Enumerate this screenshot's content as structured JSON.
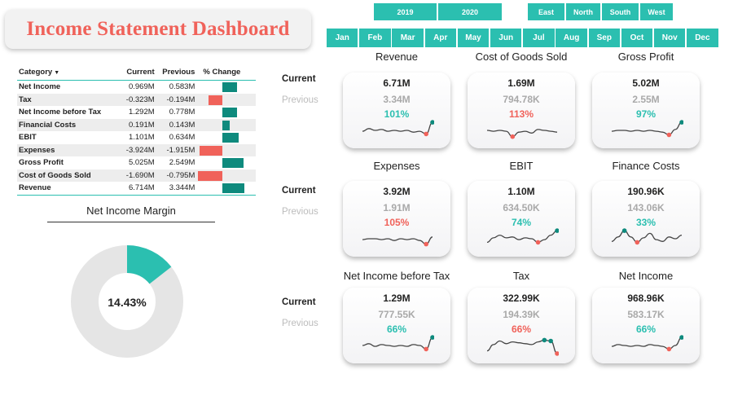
{
  "title": "Income Statement Dashboard",
  "years": [
    "2019",
    "2020"
  ],
  "regions": [
    "East",
    "North",
    "South",
    "West"
  ],
  "months": [
    "Jan",
    "Feb",
    "Mar",
    "Apr",
    "May",
    "Jun",
    "Jul",
    "Aug",
    "Sep",
    "Oct",
    "Nov",
    "Dec"
  ],
  "table": {
    "headers": {
      "category": "Category",
      "current": "Current",
      "previous": "Previous",
      "change": "% Change"
    },
    "rows": [
      {
        "category": "Net Income",
        "current": "0.969M",
        "previous": "0.583M",
        "change_pct": 66
      },
      {
        "category": "Tax",
        "current": "-0.323M",
        "previous": "-0.194M",
        "change_pct": -66
      },
      {
        "category": "Net Income before Tax",
        "current": "1.292M",
        "previous": "0.778M",
        "change_pct": 66
      },
      {
        "category": "Financial Costs",
        "current": "0.191M",
        "previous": "0.143M",
        "change_pct": 33
      },
      {
        "category": "EBIT",
        "current": "1.101M",
        "previous": "0.634M",
        "change_pct": 74
      },
      {
        "category": "Expenses",
        "current": "-3.924M",
        "previous": "-1.915M",
        "change_pct": -105
      },
      {
        "category": "Gross Profit",
        "current": "5.025M",
        "previous": "2.549M",
        "change_pct": 97
      },
      {
        "category": "Cost of Goods Sold",
        "current": "-1.690M",
        "previous": "-0.795M",
        "change_pct": -113
      },
      {
        "category": "Revenue",
        "current": "6.714M",
        "previous": "3.344M",
        "change_pct": 101
      }
    ]
  },
  "net_income_margin": {
    "title": "Net Income Margin",
    "value_label": "14.43%",
    "value": 14.43
  },
  "row_labels": {
    "current": "Current",
    "previous": "Previous"
  },
  "colors": {
    "teal": "#2bbfb0",
    "dark_teal": "#0e8a7d",
    "red": "#f0625a",
    "grey": "#e5e5e5"
  },
  "cards": [
    {
      "title": "Revenue",
      "current": "6.71M",
      "previous": "3.34M",
      "pct": "101%",
      "good": true,
      "spark": [
        0.45,
        0.6,
        0.5,
        0.55,
        0.45,
        0.5,
        0.45,
        0.5,
        0.4,
        0.45,
        0.3,
        0.95
      ],
      "low": 10,
      "high": 11
    },
    {
      "title": "Cost of Goods Sold",
      "current": "1.69M",
      "previous": "794.78K",
      "pct": "113%",
      "good": false,
      "spark": [
        0.5,
        0.45,
        0.5,
        0.45,
        0.15,
        0.4,
        0.45,
        0.35,
        0.55,
        0.5,
        0.45,
        0.4
      ],
      "low": 4,
      "high": null
    },
    {
      "title": "Gross Profit",
      "current": "5.02M",
      "previous": "2.55M",
      "pct": "97%",
      "good": true,
      "spark": [
        0.45,
        0.5,
        0.5,
        0.45,
        0.5,
        0.45,
        0.5,
        0.45,
        0.4,
        0.25,
        0.55,
        0.95
      ],
      "low": 9,
      "high": 11
    },
    {
      "title": "Expenses",
      "current": "3.92M",
      "previous": "1.91M",
      "pct": "105%",
      "good": false,
      "spark": [
        0.45,
        0.5,
        0.5,
        0.45,
        0.5,
        0.4,
        0.5,
        0.45,
        0.5,
        0.4,
        0.2,
        0.6
      ],
      "low": 10,
      "high": null
    },
    {
      "title": "EBIT",
      "current": "1.10M",
      "previous": "634.50K",
      "pct": "74%",
      "good": true,
      "spark": [
        0.3,
        0.55,
        0.7,
        0.55,
        0.6,
        0.45,
        0.55,
        0.5,
        0.3,
        0.45,
        0.7,
        0.95
      ],
      "low": 8,
      "high": 11
    },
    {
      "title": "Finance Costs",
      "current": "190.96K",
      "previous": "143.06K",
      "pct": "33%",
      "good": true,
      "spark": [
        0.35,
        0.6,
        0.95,
        0.6,
        0.3,
        0.55,
        0.8,
        0.45,
        0.35,
        0.6,
        0.5,
        0.7
      ],
      "low": 4,
      "high": 2
    },
    {
      "title": "Net Income before Tax",
      "current": "1.29M",
      "previous": "777.55K",
      "pct": "66%",
      "good": true,
      "spark": [
        0.5,
        0.6,
        0.45,
        0.55,
        0.5,
        0.45,
        0.5,
        0.45,
        0.55,
        0.5,
        0.3,
        0.95
      ],
      "low": 10,
      "high": 11
    },
    {
      "title": "Tax",
      "current": "322.99K",
      "previous": "194.39K",
      "pct": "66%",
      "good": false,
      "spark": [
        0.2,
        0.55,
        0.75,
        0.6,
        0.7,
        0.65,
        0.6,
        0.55,
        0.7,
        0.8,
        0.75,
        0.05
      ],
      "low": 11,
      "high": 9
    },
    {
      "title": "Net Income",
      "current": "968.96K",
      "previous": "583.17K",
      "pct": "66%",
      "good": true,
      "spark": [
        0.45,
        0.55,
        0.5,
        0.45,
        0.5,
        0.45,
        0.55,
        0.5,
        0.45,
        0.3,
        0.5,
        0.95
      ],
      "low": 9,
      "high": 11
    }
  ]
}
